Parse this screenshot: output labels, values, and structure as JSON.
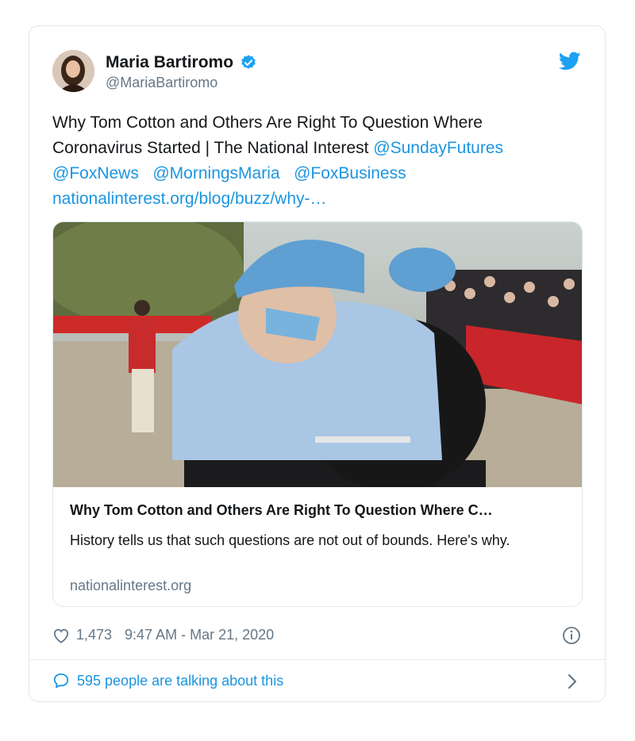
{
  "author": {
    "name": "Maria Bartiromo",
    "handle": "@MariaBartiromo"
  },
  "tweet": {
    "line1": "Why Tom Cotton and Others Are Right To Question Where",
    "line2_text": "Coronavirus Started | The National Interest ",
    "mentions": [
      "@SundayFutures",
      "@FoxNews",
      "@MorningsMaria",
      "@FoxBusiness"
    ],
    "url": "nationalinterest.org/blog/buzz/why-…"
  },
  "link_card": {
    "title": "Why Tom Cotton and Others Are Right To Question Where C…",
    "description": "History tells us that such questions are not out of bounds. Here's why.",
    "domain": "nationalinterest.org"
  },
  "footer": {
    "likes": "1,473",
    "timestamp": "9:47 AM - Mar 21, 2020",
    "talking": "595 people are talking about this"
  },
  "colors": {
    "link": "#1b95e0",
    "muted": "#657786",
    "border": "#e1e8ed"
  }
}
